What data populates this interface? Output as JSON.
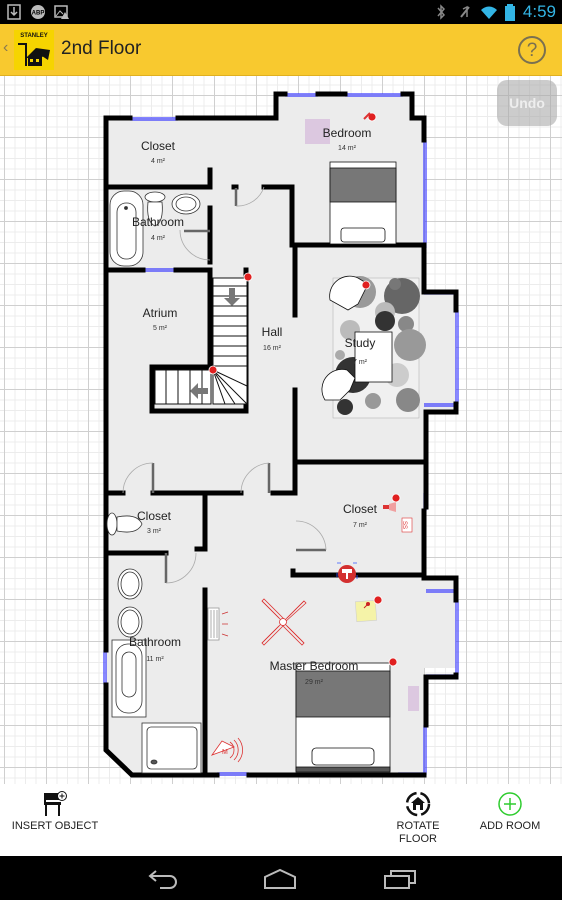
{
  "status_bar": {
    "left_icons": [
      "download-icon",
      "adblock-icon",
      "image-warning-icon"
    ],
    "right_icons": [
      "bluetooth-icon",
      "mute-icon",
      "wifi-icon",
      "battery-icon"
    ],
    "time": "4:59"
  },
  "app_bar": {
    "back_glyph": "‹",
    "logo_text": "STANLEY",
    "title": "2nd Floor",
    "help_glyph": "?"
  },
  "canvas": {
    "undo_label": "Undo",
    "rooms": [
      {
        "name": "Closet",
        "area": "4 m²"
      },
      {
        "name": "Bedroom",
        "area": "14 m²"
      },
      {
        "name": "Bathroom",
        "area": "4 m²"
      },
      {
        "name": "Atrium",
        "area": "5 m²"
      },
      {
        "name": "Hall",
        "area": "16 m²"
      },
      {
        "name": "Study",
        "area": "7 m²"
      },
      {
        "name": "Closet",
        "area": "3 m²"
      },
      {
        "name": "Closet",
        "area": "7 m²"
      },
      {
        "name": "Bathroom",
        "area": "11 m²"
      },
      {
        "name": "Master Bedroom",
        "area": "29 m²"
      }
    ],
    "colors": {
      "wall": "#000000",
      "floor": "#ececec",
      "window": "#3a3aff",
      "accent_red": "#d32f2f",
      "rug_pink": "#dcc8e0",
      "note_yellow": "#f5f3a8"
    }
  },
  "toolbar": {
    "insert_object": "INSERT OBJECT",
    "rotate_floor_line1": "ROTATE",
    "rotate_floor_line2": "FLOOR",
    "add_room": "ADD ROOM",
    "add_room_color": "#2ecc2e"
  },
  "nav_bar": {
    "buttons": [
      "back-icon",
      "home-icon",
      "recents-icon"
    ]
  }
}
